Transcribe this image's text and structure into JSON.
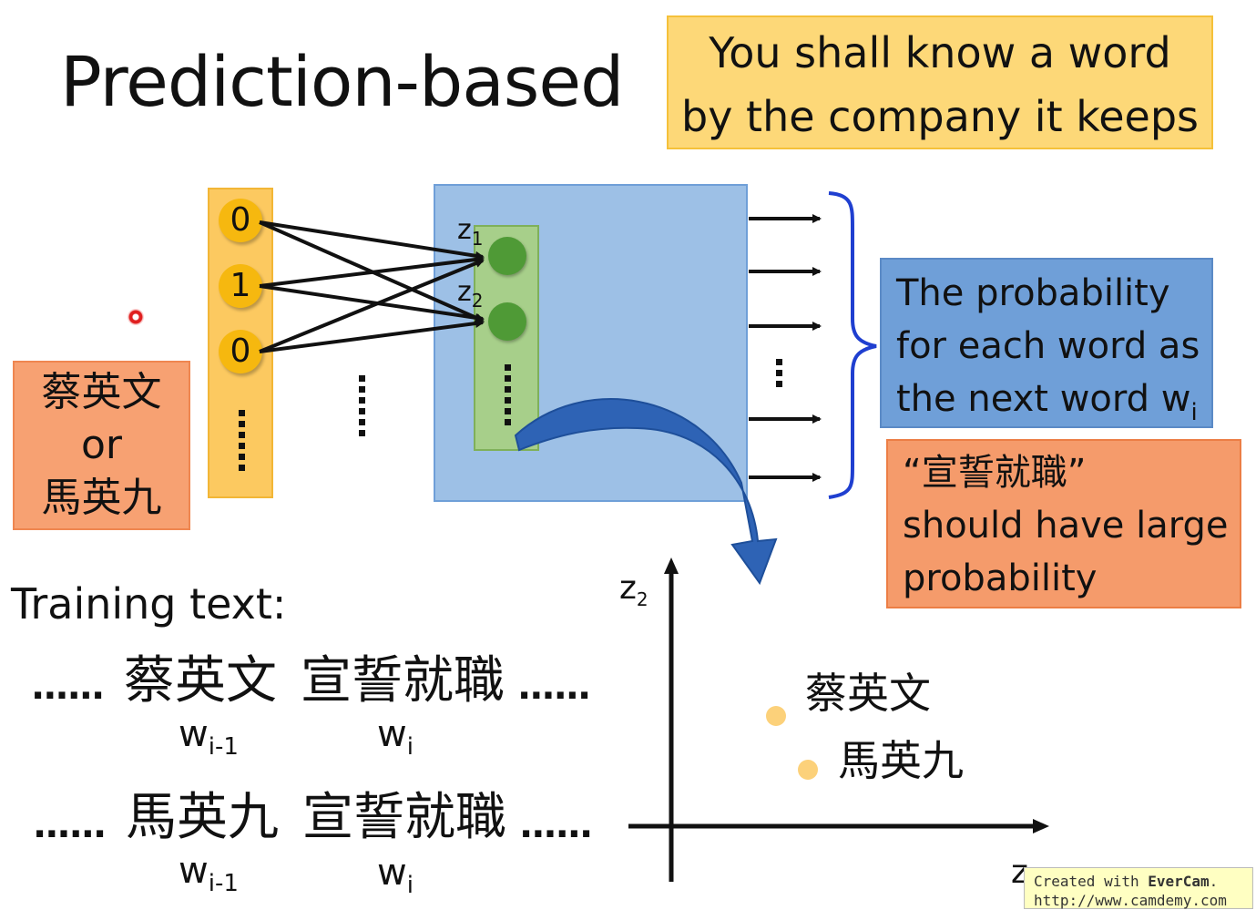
{
  "slide": {
    "title": "Prediction-based",
    "quote_line1": "You shall know a word",
    "quote_line2": "by the company it keeps"
  },
  "output_box": {
    "line1": "The probability",
    "line2": "for each word as",
    "line3_prefix": "the next word w",
    "line3_sub": "i"
  },
  "target_box": {
    "line1": "“宣誓就職”",
    "line2": "should have large",
    "line3": "probability"
  },
  "input_box": {
    "line1": "蔡英文",
    "line2": "or",
    "line3": "馬英九"
  },
  "one_hot": {
    "values": [
      "0",
      "1",
      "0"
    ],
    "ellipsis": "⋮"
  },
  "hidden": {
    "z1": "z",
    "z1_sub": "1",
    "z2": "z",
    "z2_sub": "2"
  },
  "training": {
    "heading": "Training text:",
    "rows": [
      {
        "lead": "......",
        "w_prev": "蔡英文",
        "w_cur": "宣誓就職",
        "trail": "......",
        "w_prev_label": "w",
        "w_prev_sub": "i-1",
        "w_cur_label": "w",
        "w_cur_sub": "i"
      },
      {
        "lead": "......",
        "w_prev": "馬英九",
        "w_cur": "宣誓就職",
        "trail": "......",
        "w_prev_label": "w",
        "w_prev_sub": "i-1",
        "w_cur_label": "w",
        "w_cur_sub": "i"
      }
    ]
  },
  "plot": {
    "y_label": "z",
    "y_sub": "2",
    "x_label": "z",
    "points": [
      "蔡英文",
      "馬英九"
    ]
  },
  "watermark": {
    "line1_prefix": "Created with ",
    "line1_brand": "EverCam",
    "line1_suffix": ".",
    "line2": "http://www.camdemy.com"
  },
  "colors": {
    "quote_bg": "#fdd878",
    "output_bg": "#6f9fd8",
    "target_bg": "#f59b6b",
    "input_bg": "#f7a172",
    "network_bg": "#9dc0e6",
    "hidden_bg": "#a7cf8a",
    "node_orange": "#f6b80f",
    "node_green": "#4f9a36",
    "brace_blue": "#1f3fd0",
    "curve_arrow": "#2e63b5",
    "point_fill": "#fcd17a"
  }
}
